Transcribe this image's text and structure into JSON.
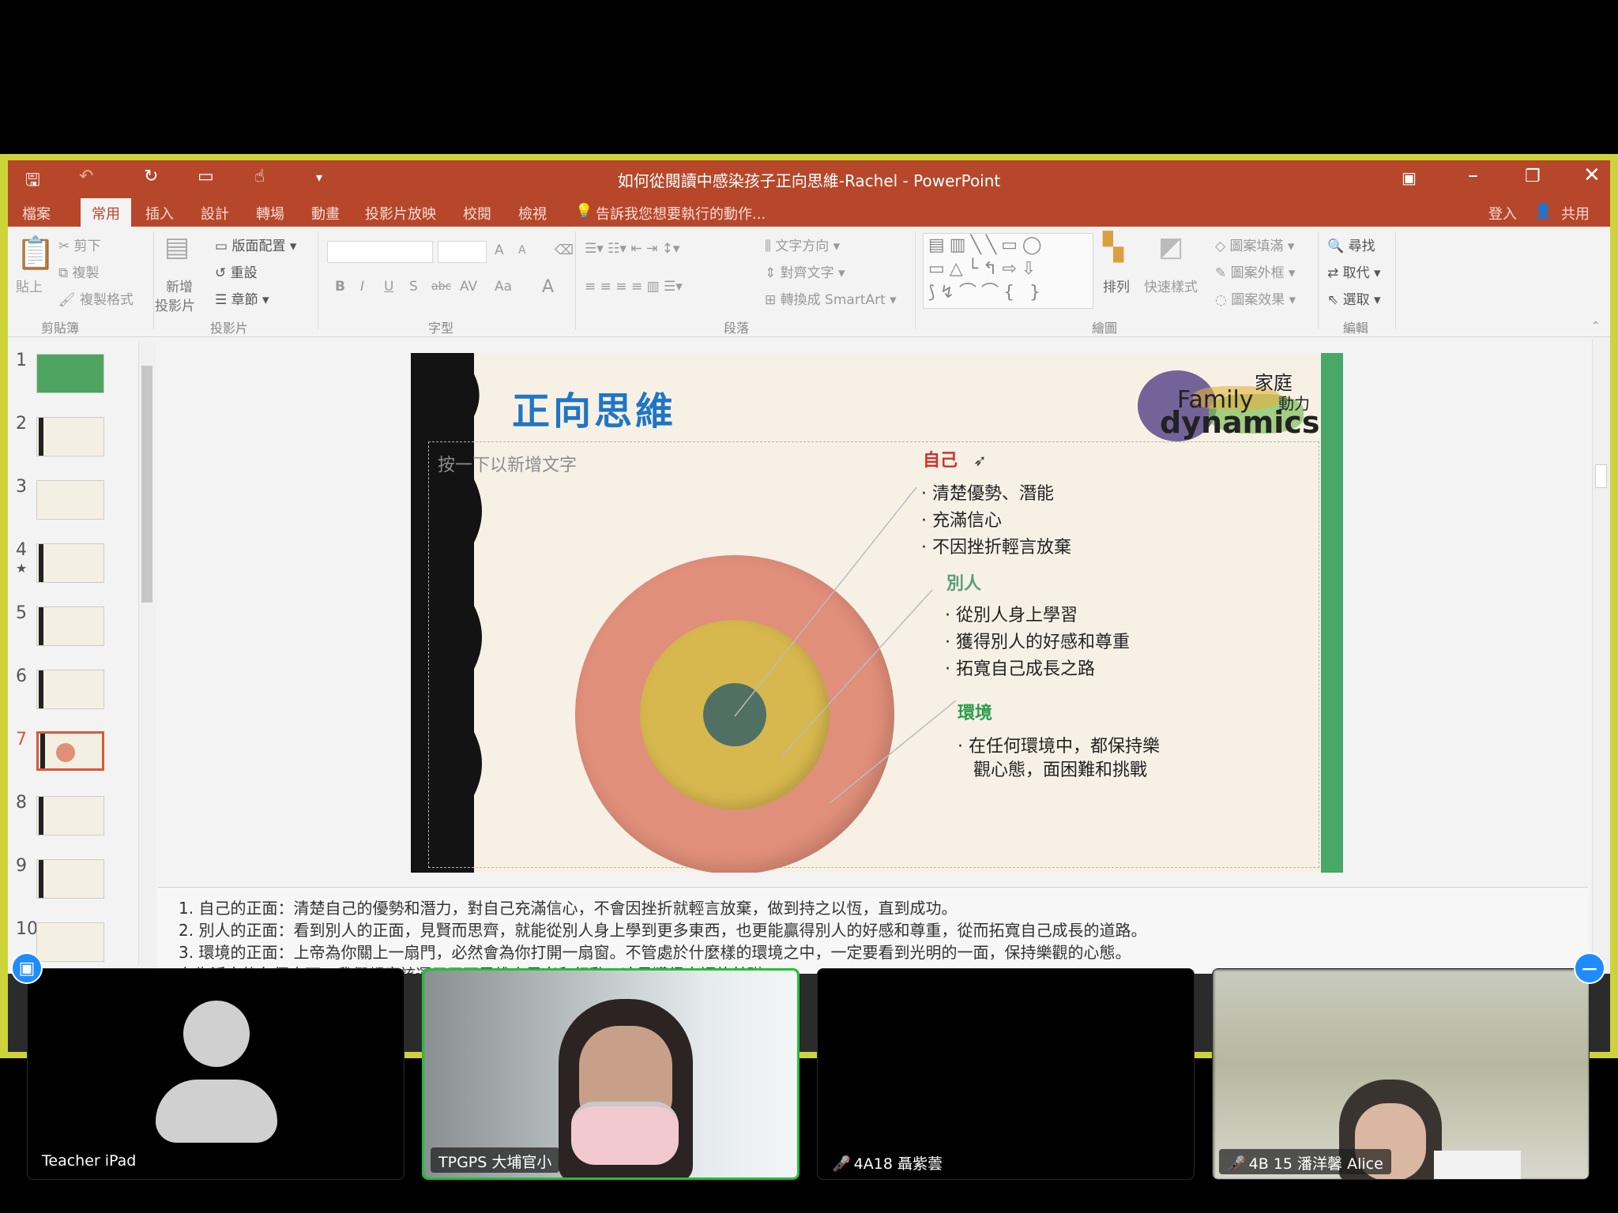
{
  "window": {
    "title": "如何從閱讀中感染孩子正向思維-Rachel - PowerPoint",
    "tabs": [
      "檔案",
      "常用",
      "插入",
      "設計",
      "轉場",
      "動畫",
      "投影片放映",
      "校閱",
      "檢視"
    ],
    "active_tab": "常用",
    "tell_me": "告訴我您想要執行的動作...",
    "sign_in": "登入",
    "share": "共用"
  },
  "ribbon": {
    "clipboard": {
      "paste": "貼上",
      "cut": "剪下",
      "copy": "複製",
      "format_painter": "複製格式",
      "label": "剪貼簿"
    },
    "slides": {
      "new_slide_1": "新增",
      "new_slide_2": "投影片",
      "layout": "版面配置",
      "reset": "重設",
      "section": "章節",
      "label": "投影片"
    },
    "font": {
      "label": "字型",
      "bold": "B",
      "italic": "I",
      "underline": "U",
      "strike": "S",
      "clear": "abc",
      "spacing": "AV",
      "case": "Aa",
      "color": "A",
      "grow": "A",
      "shrink": "A"
    },
    "paragraph": {
      "text_direction": "文字方向",
      "align_text": "對齊文字",
      "smartart": "轉換成 SmartArt",
      "label": "段落"
    },
    "drawing": {
      "arrange": "排列",
      "quick_styles": "快速樣式",
      "fill": "圖案填滿",
      "outline": "圖案外框",
      "effects": "圖案效果",
      "label": "繪圖"
    },
    "editing": {
      "find": "尋找",
      "replace": "取代",
      "select": "選取",
      "label": "編輯"
    }
  },
  "thumbnails": [
    {
      "num": "1",
      "star": ""
    },
    {
      "num": "2",
      "star": ""
    },
    {
      "num": "3",
      "star": ""
    },
    {
      "num": "4",
      "star": "★"
    },
    {
      "num": "5",
      "star": ""
    },
    {
      "num": "6",
      "star": ""
    },
    {
      "num": "7",
      "star": ""
    },
    {
      "num": "8",
      "star": ""
    },
    {
      "num": "9",
      "star": ""
    },
    {
      "num": "10",
      "star": ""
    }
  ],
  "slide": {
    "title": "正向思維",
    "placeholder": "按一下以新增文字",
    "logo_cn": "家庭",
    "logo_family": "Family",
    "logo_dong": "動力",
    "logo_dynamics": "dynamics",
    "self": {
      "heading": "自己",
      "items": [
        "清楚優勢、潛能",
        "充滿信心",
        "不因挫折輕言放棄"
      ]
    },
    "others": {
      "heading": "別人",
      "items": [
        "從別人身上學習",
        "獲得別人的好感和尊重",
        "拓寬自己成長之路"
      ]
    },
    "environment": {
      "heading": "環境",
      "items": [
        "在任何環境中，都保持樂",
        "觀心態，面困難和挑戰"
      ]
    },
    "colors": {
      "title": "#1f76c5",
      "self": "#d0312d",
      "others": "#5a9e7a",
      "environment": "#2e9c4f",
      "outer_ring": "#e08f7a",
      "middle_ring": "#d7b84e",
      "core": "#4f7063"
    }
  },
  "notes": [
    "1.   自己的正面：清楚自己的優勢和潛力，對自己充滿信心，不會因挫折就輕言放棄，做到持之以恆，直到成功。",
    "2.   別人的正面：看到別人的正面，見賢而思齊，就能從別人身上學到更多東西，也更能贏得別人的好感和尊重，從而拓寬自己成長的道路。",
    "3.   環境的正面：上帝為你關上一扇門，必然會為你打開一扇窗。不管處於什麼樣的環境之中，一定要看到光明的一面，保持樂觀的心態。",
    "在生活中的各個方面，我們都應該運用正面思維來思考和行動，這是獲得幸福的基礎。"
  ],
  "participants": [
    {
      "name": "Teacher iPad",
      "muted": false,
      "video": "avatar",
      "speaking": false
    },
    {
      "name": "TPGPS 大埔官小",
      "muted": false,
      "video": "camera",
      "speaking": true
    },
    {
      "name": "4A18 聶紫蕓",
      "muted": true,
      "video": "off",
      "speaking": false
    },
    {
      "name": "4B 15 潘洋馨 Alice",
      "muted": true,
      "video": "camera",
      "speaking": false
    }
  ]
}
